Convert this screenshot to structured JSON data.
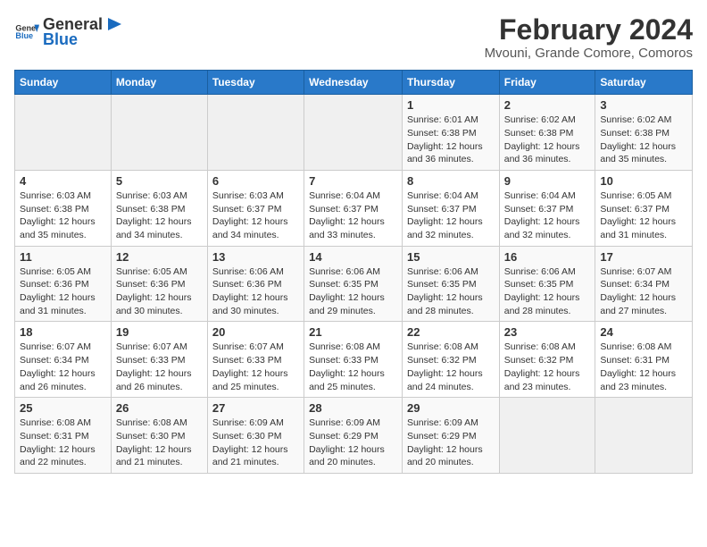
{
  "header": {
    "logo_general": "General",
    "logo_blue": "Blue",
    "title": "February 2024",
    "subtitle": "Mvouni, Grande Comore, Comoros"
  },
  "calendar": {
    "days_of_week": [
      "Sunday",
      "Monday",
      "Tuesday",
      "Wednesday",
      "Thursday",
      "Friday",
      "Saturday"
    ],
    "weeks": [
      [
        {
          "day": "",
          "info": ""
        },
        {
          "day": "",
          "info": ""
        },
        {
          "day": "",
          "info": ""
        },
        {
          "day": "",
          "info": ""
        },
        {
          "day": "1",
          "info": "Sunrise: 6:01 AM\nSunset: 6:38 PM\nDaylight: 12 hours and 36 minutes."
        },
        {
          "day": "2",
          "info": "Sunrise: 6:02 AM\nSunset: 6:38 PM\nDaylight: 12 hours and 36 minutes."
        },
        {
          "day": "3",
          "info": "Sunrise: 6:02 AM\nSunset: 6:38 PM\nDaylight: 12 hours and 35 minutes."
        }
      ],
      [
        {
          "day": "4",
          "info": "Sunrise: 6:03 AM\nSunset: 6:38 PM\nDaylight: 12 hours and 35 minutes."
        },
        {
          "day": "5",
          "info": "Sunrise: 6:03 AM\nSunset: 6:38 PM\nDaylight: 12 hours and 34 minutes."
        },
        {
          "day": "6",
          "info": "Sunrise: 6:03 AM\nSunset: 6:37 PM\nDaylight: 12 hours and 34 minutes."
        },
        {
          "day": "7",
          "info": "Sunrise: 6:04 AM\nSunset: 6:37 PM\nDaylight: 12 hours and 33 minutes."
        },
        {
          "day": "8",
          "info": "Sunrise: 6:04 AM\nSunset: 6:37 PM\nDaylight: 12 hours and 32 minutes."
        },
        {
          "day": "9",
          "info": "Sunrise: 6:04 AM\nSunset: 6:37 PM\nDaylight: 12 hours and 32 minutes."
        },
        {
          "day": "10",
          "info": "Sunrise: 6:05 AM\nSunset: 6:37 PM\nDaylight: 12 hours and 31 minutes."
        }
      ],
      [
        {
          "day": "11",
          "info": "Sunrise: 6:05 AM\nSunset: 6:36 PM\nDaylight: 12 hours and 31 minutes."
        },
        {
          "day": "12",
          "info": "Sunrise: 6:05 AM\nSunset: 6:36 PM\nDaylight: 12 hours and 30 minutes."
        },
        {
          "day": "13",
          "info": "Sunrise: 6:06 AM\nSunset: 6:36 PM\nDaylight: 12 hours and 30 minutes."
        },
        {
          "day": "14",
          "info": "Sunrise: 6:06 AM\nSunset: 6:35 PM\nDaylight: 12 hours and 29 minutes."
        },
        {
          "day": "15",
          "info": "Sunrise: 6:06 AM\nSunset: 6:35 PM\nDaylight: 12 hours and 28 minutes."
        },
        {
          "day": "16",
          "info": "Sunrise: 6:06 AM\nSunset: 6:35 PM\nDaylight: 12 hours and 28 minutes."
        },
        {
          "day": "17",
          "info": "Sunrise: 6:07 AM\nSunset: 6:34 PM\nDaylight: 12 hours and 27 minutes."
        }
      ],
      [
        {
          "day": "18",
          "info": "Sunrise: 6:07 AM\nSunset: 6:34 PM\nDaylight: 12 hours and 26 minutes."
        },
        {
          "day": "19",
          "info": "Sunrise: 6:07 AM\nSunset: 6:33 PM\nDaylight: 12 hours and 26 minutes."
        },
        {
          "day": "20",
          "info": "Sunrise: 6:07 AM\nSunset: 6:33 PM\nDaylight: 12 hours and 25 minutes."
        },
        {
          "day": "21",
          "info": "Sunrise: 6:08 AM\nSunset: 6:33 PM\nDaylight: 12 hours and 25 minutes."
        },
        {
          "day": "22",
          "info": "Sunrise: 6:08 AM\nSunset: 6:32 PM\nDaylight: 12 hours and 24 minutes."
        },
        {
          "day": "23",
          "info": "Sunrise: 6:08 AM\nSunset: 6:32 PM\nDaylight: 12 hours and 23 minutes."
        },
        {
          "day": "24",
          "info": "Sunrise: 6:08 AM\nSunset: 6:31 PM\nDaylight: 12 hours and 23 minutes."
        }
      ],
      [
        {
          "day": "25",
          "info": "Sunrise: 6:08 AM\nSunset: 6:31 PM\nDaylight: 12 hours and 22 minutes."
        },
        {
          "day": "26",
          "info": "Sunrise: 6:08 AM\nSunset: 6:30 PM\nDaylight: 12 hours and 21 minutes."
        },
        {
          "day": "27",
          "info": "Sunrise: 6:09 AM\nSunset: 6:30 PM\nDaylight: 12 hours and 21 minutes."
        },
        {
          "day": "28",
          "info": "Sunrise: 6:09 AM\nSunset: 6:29 PM\nDaylight: 12 hours and 20 minutes."
        },
        {
          "day": "29",
          "info": "Sunrise: 6:09 AM\nSunset: 6:29 PM\nDaylight: 12 hours and 20 minutes."
        },
        {
          "day": "",
          "info": ""
        },
        {
          "day": "",
          "info": ""
        }
      ]
    ]
  }
}
